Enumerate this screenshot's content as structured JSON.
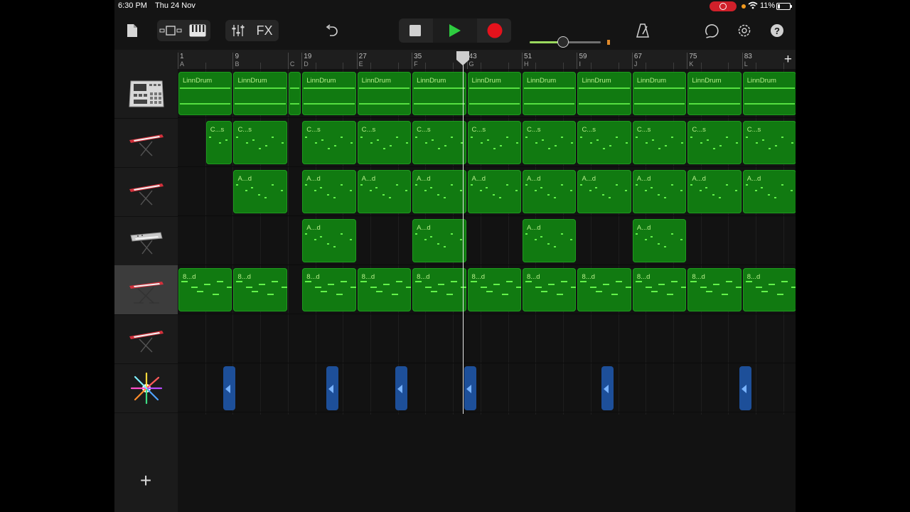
{
  "status": {
    "time": "6:30 PM",
    "date": "Thu 24 Nov",
    "battery": "11%"
  },
  "toolbar": {
    "fx_label": "FX",
    "help_label": "?",
    "master_volume_fraction": 0.47
  },
  "ruler": {
    "bars": [
      {
        "num": "1",
        "section": "A"
      },
      {
        "num": "9",
        "section": "B"
      },
      {
        "num": "",
        "section": "C"
      },
      {
        "num": "19",
        "section": "D"
      },
      {
        "num": "27",
        "section": "E"
      },
      {
        "num": "35",
        "section": "F"
      },
      {
        "num": "43",
        "section": "G"
      },
      {
        "num": "51",
        "section": "H"
      },
      {
        "num": "59",
        "section": "I"
      },
      {
        "num": "67",
        "section": "J"
      },
      {
        "num": "75",
        "section": "K"
      },
      {
        "num": "83",
        "section": "L"
      }
    ],
    "add_section_label": "+"
  },
  "tracks": [
    {
      "instrument": "drum-machine",
      "region_label": "LinnDrum"
    },
    {
      "instrument": "red-keyboard",
      "region_label": "C...s"
    },
    {
      "instrument": "red-keyboard",
      "region_label": "A...d"
    },
    {
      "instrument": "grey-synth",
      "region_label": "A...d"
    },
    {
      "instrument": "red-keyboard",
      "region_label": "8...d",
      "selected": true
    },
    {
      "instrument": "red-keyboard",
      "region_label": ""
    },
    {
      "instrument": "sparkle-fx",
      "region_label": ""
    }
  ],
  "add_track_label": "+",
  "colors": {
    "region": "#117a11",
    "note": "#63f24a",
    "automation": "#1d4f99",
    "record": "#e5121c",
    "play": "#2ecc40"
  }
}
